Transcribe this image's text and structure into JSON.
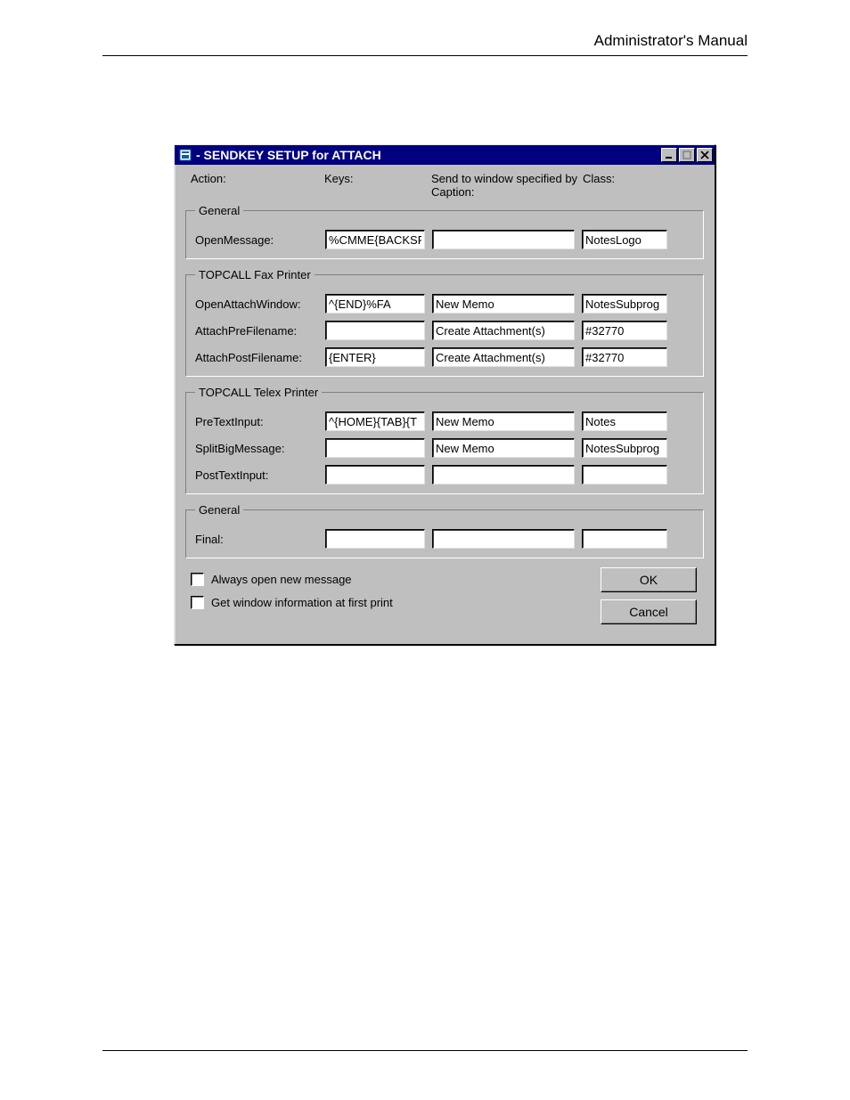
{
  "page": {
    "header": "Administrator's Manual"
  },
  "window": {
    "title": "- SENDKEY SETUP for ATTACH"
  },
  "headers": {
    "action": "Action:",
    "keys": "Keys:",
    "sentto": "Send to window specified by",
    "caption": "Caption:",
    "class": "Class:"
  },
  "groups": {
    "g1": {
      "legend": "General",
      "rows": {
        "openmsg": {
          "label": "OpenMessage:",
          "keys": "%CMME{BACKSP",
          "caption": "",
          "class": "NotesLogo"
        }
      }
    },
    "g2": {
      "legend": "TOPCALL Fax Printer",
      "rows": {
        "openattach": {
          "label": "OpenAttachWindow:",
          "keys": "^{END}%FA",
          "caption": "New Memo",
          "class": "NotesSubprog"
        },
        "attachpre": {
          "label": "AttachPreFilename:",
          "keys": "",
          "caption": "Create Attachment(s)",
          "class": "#32770"
        },
        "attachpost": {
          "label": "AttachPostFilename:",
          "keys": "{ENTER}",
          "caption": "Create Attachment(s)",
          "class": "#32770"
        }
      }
    },
    "g3": {
      "legend": "TOPCALL Telex Printer",
      "rows": {
        "pretext": {
          "label": "PreTextInput:",
          "keys": "^{HOME}{TAB}{T",
          "caption": "New Memo",
          "class": "Notes"
        },
        "splitbig": {
          "label": "SplitBigMessage:",
          "keys": "",
          "caption": "New Memo",
          "class": "NotesSubprog"
        },
        "posttext": {
          "label": "PostTextInput:",
          "keys": "",
          "caption": "",
          "class": ""
        }
      }
    },
    "g4": {
      "legend": "General",
      "rows": {
        "final": {
          "label": "Final:",
          "keys": "",
          "caption": "",
          "class": ""
        }
      }
    }
  },
  "checks": {
    "always": "Always open new message",
    "getwin": "Get window information at first print"
  },
  "buttons": {
    "ok": "OK",
    "cancel": "Cancel"
  }
}
